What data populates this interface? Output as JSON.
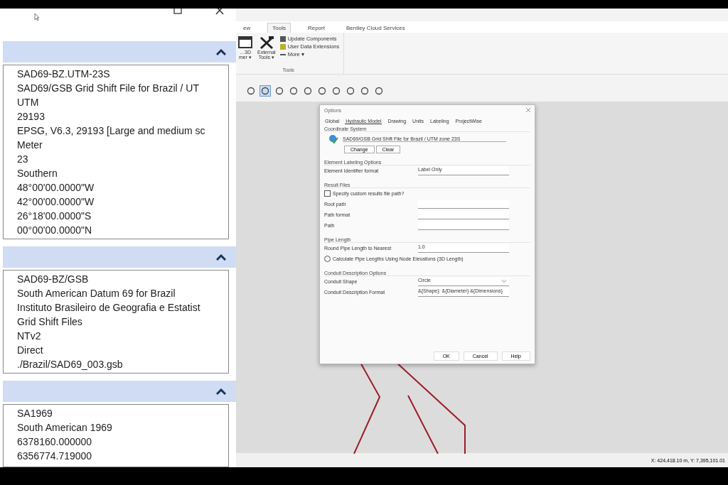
{
  "left_panel": {
    "sections": [
      {
        "expanded": true,
        "lines": [
          "SAD69-BZ.UTM-23S",
          "SAD69/GSB Grid Shift File for Brazil / UT",
          "UTM",
          "29193",
          "EPSG, V6.3, 29193 [Large and medium sc",
          "Meter",
          "23",
          "Southern",
          "48°00'00.0000\"W",
          "42°00'00.0000\"W",
          "26°18'00.0000\"S",
          "00°00'00.0000\"N"
        ]
      },
      {
        "expanded": true,
        "lines": [
          "SAD69-BZ/GSB",
          "South American Datum 69 for Brazil",
          "Instituto Brasileiro de Geografia e Estatist",
          "Grid Shift Files",
          "NTv2",
          "Direct",
          "./Brazil/SAD69_003.gsb"
        ]
      },
      {
        "expanded": true,
        "lines": [
          "SA1969",
          "South American 1969",
          "6378160.000000",
          "6356774.719000"
        ]
      }
    ]
  },
  "ribbon": {
    "tabs": [
      {
        "label": "ew",
        "selected": false
      },
      {
        "label": "Tools",
        "selected": true
      },
      {
        "label": "Report",
        "selected": false
      },
      {
        "label": "Bentley Cloud Services",
        "selected": false
      }
    ],
    "large_commands": [
      "…3D\nmer ▾",
      "External\nTools ▾"
    ],
    "small_commands": [
      "Update Components",
      "User Data Extensions",
      "More ▾"
    ],
    "group_label": "Tools"
  },
  "dialog": {
    "title": "Options",
    "tabs": [
      {
        "label": "Global",
        "selected": false
      },
      {
        "label": "Hydraulic Model",
        "selected": true
      },
      {
        "label": "Drawing",
        "selected": false
      },
      {
        "label": "Units",
        "selected": false
      },
      {
        "label": "Labeling",
        "selected": false
      },
      {
        "label": "ProjectWise",
        "selected": false
      }
    ],
    "coordinate_system": {
      "title": "Coordinate System",
      "value": "SAD69/GSB Grid Shift File for Brazil / UTM zone 23S",
      "buttons": [
        "Change",
        "Clear"
      ]
    },
    "sections": [
      {
        "title": "Element Labeling Options",
        "rows": [
          {
            "kind": "field",
            "label": "Element Identifier format",
            "value": "Label Only"
          }
        ]
      },
      {
        "title": "Result Files",
        "rows": [
          {
            "kind": "checkbox",
            "label": "Specify custom results file path?",
            "checked": false
          },
          {
            "kind": "field",
            "label": "Root path",
            "value": ""
          },
          {
            "kind": "field",
            "label": "Path format",
            "value": ""
          },
          {
            "kind": "field",
            "label": "Path",
            "value": ""
          }
        ]
      },
      {
        "title": "Pipe Length",
        "rows": [
          {
            "kind": "field",
            "label": "Round Pipe Length to Nearest",
            "value": "1.0"
          },
          {
            "kind": "radio",
            "label": "Calculate Pipe Lengths Using Node Elevations (3D Length)",
            "checked": false
          }
        ]
      },
      {
        "title": "Conduit Description Options",
        "rows": [
          {
            "kind": "dropdown",
            "label": "Conduit Shape",
            "value": "Circle"
          },
          {
            "kind": "field",
            "label": "Conduit Description Format",
            "value": "&{Shape}: &{Diameter} &{Dimensions}"
          }
        ]
      }
    ],
    "buttons": [
      "OK",
      "Cancel",
      "Help"
    ]
  },
  "status_bar": {
    "coordinates": "X: 424,418.10 m, Y: 7,395,101.01"
  }
}
